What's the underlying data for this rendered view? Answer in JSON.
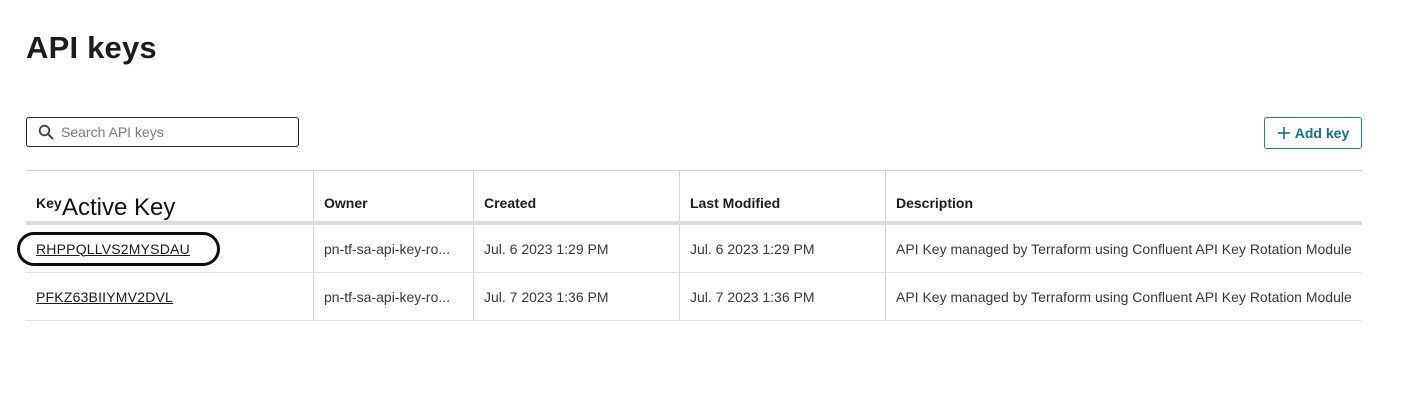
{
  "page": {
    "title": "API keys"
  },
  "search": {
    "placeholder": "Search API keys",
    "value": "",
    "icon": "search-icon"
  },
  "toolbar": {
    "add_label": "Add key",
    "add_icon": "plus-icon",
    "accent": "#12708f"
  },
  "annotation": {
    "label": "Active Key"
  },
  "table": {
    "columns": [
      "Key",
      "Owner",
      "Created",
      "Last Modified",
      "Description"
    ],
    "rows": [
      {
        "key": "RHPPQLLVS2MYSDAU",
        "owner": "pn-tf-sa-api-key-ro...",
        "created": "Jul. 6 2023 1:29 PM",
        "modified": "Jul. 6 2023 1:29 PM",
        "description": "API Key managed by Terraform using Confluent API Key Rotation Module"
      },
      {
        "key": "PFKZ63BIIYMV2DVL",
        "owner": "pn-tf-sa-api-key-ro...",
        "created": "Jul. 7 2023 1:36 PM",
        "modified": "Jul. 7 2023 1:36 PM",
        "description": "API Key managed by Terraform using Confluent API Key Rotation Module"
      }
    ]
  }
}
